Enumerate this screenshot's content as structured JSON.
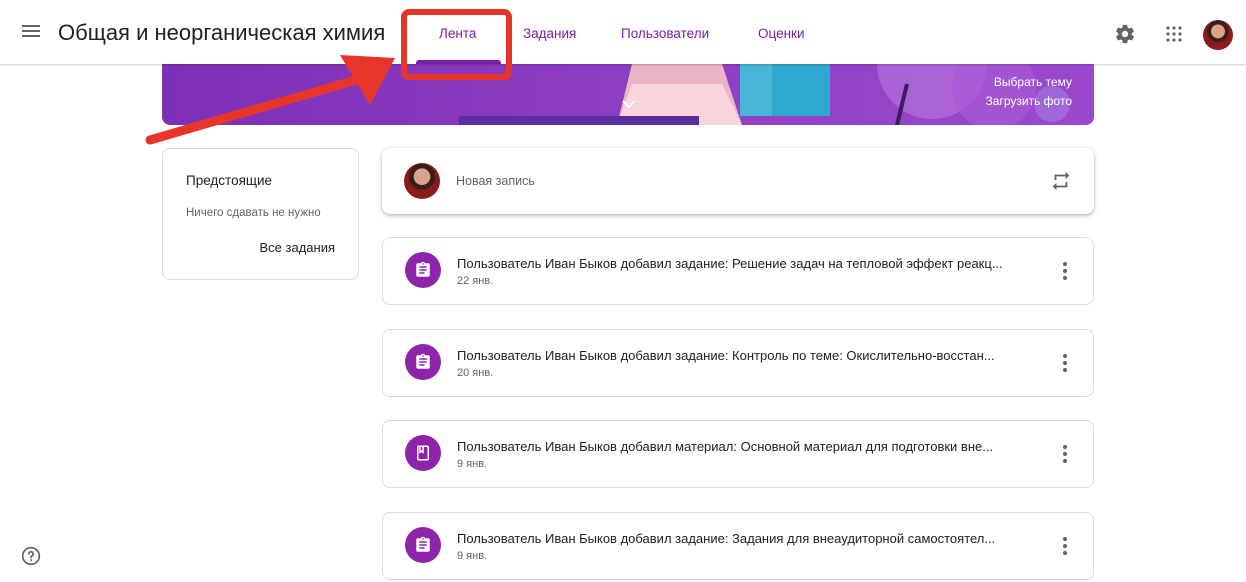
{
  "header": {
    "course_title": "Общая и неорганическая химия",
    "tabs": [
      {
        "label": "Лента",
        "active": true
      },
      {
        "label": "Задания",
        "active": false
      },
      {
        "label": "Пользователи",
        "active": false
      },
      {
        "label": "Оценки",
        "active": false
      }
    ],
    "icons": [
      "menu-icon",
      "settings-icon",
      "apps-icon",
      "avatar"
    ]
  },
  "banner": {
    "select_theme": "Выбрать тему",
    "upload_photo": "Загрузить фото"
  },
  "upcoming": {
    "title": "Предстоящие",
    "empty_text": "Ничего сдавать не нужно",
    "all_link": "Все задания"
  },
  "composer": {
    "placeholder": "Новая запись"
  },
  "feed": [
    {
      "type": "assignment",
      "text_prefix": "Пользователь ",
      "author": "Иван Быков",
      "text_suffix": " добавил задание: Решение задач на тепловой эффект реакц...",
      "date": "22 янв."
    },
    {
      "type": "assignment",
      "text_prefix": "Пользователь ",
      "author": "Иван Быков",
      "text_suffix": " добавил задание: Контроль по теме: Окислительно-восстан...",
      "date": "20 янв."
    },
    {
      "type": "material",
      "text_prefix": "Пользователь ",
      "author": "Иван Быков",
      "text_suffix": " добавил материал: Основной материал для подготовки вне...",
      "date": "9 янв."
    },
    {
      "type": "assignment",
      "text_prefix": "Пользователь ",
      "author": "Иван Быков",
      "text_suffix": " добавил задание: Задания для внеаудиторной самостоятел...",
      "date": "9 янв."
    }
  ],
  "colors": {
    "accent": "#7b1fa2",
    "banner": "#8e3fc3",
    "annotation": "#e8352a",
    "feed_icon": "#8e24aa"
  }
}
